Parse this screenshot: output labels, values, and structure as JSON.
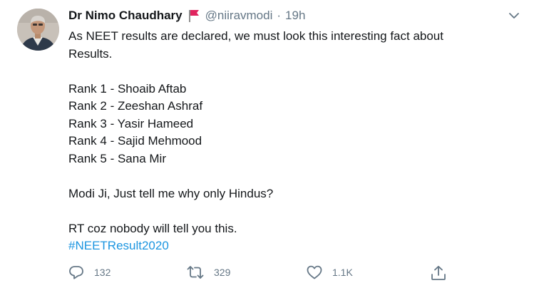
{
  "author": {
    "name": "Dr Nimo Chaudhary",
    "handle": "@niiravmodi",
    "separator": "·",
    "time": "19h"
  },
  "tweet": {
    "lines": [
      "As NEET results are declared, we must look this interesting fact about",
      "Results.",
      "",
      "Rank 1 - Shoaib Aftab",
      "Rank 2 - Zeeshan Ashraf",
      "Rank 3 - Yasir Hameed",
      "Rank 4 - Sajid Mehmood",
      "Rank 5 - Sana Mir",
      "",
      "Modi Ji, Just tell me why only Hindus?",
      "",
      "RT coz nobody will tell you this."
    ],
    "hashtag": "#NEETResult2020"
  },
  "actions": {
    "replies": "132",
    "retweets": "329",
    "likes": "1.1K"
  },
  "colors": {
    "text": "#14171a",
    "muted": "#657786",
    "link": "#1b95e0",
    "flag": "#e0245e"
  },
  "icons": {
    "flag": "red-flag-icon",
    "caret": "chevron-down-icon",
    "reply": "reply-icon",
    "retweet": "retweet-icon",
    "like": "heart-icon",
    "share": "share-icon"
  }
}
